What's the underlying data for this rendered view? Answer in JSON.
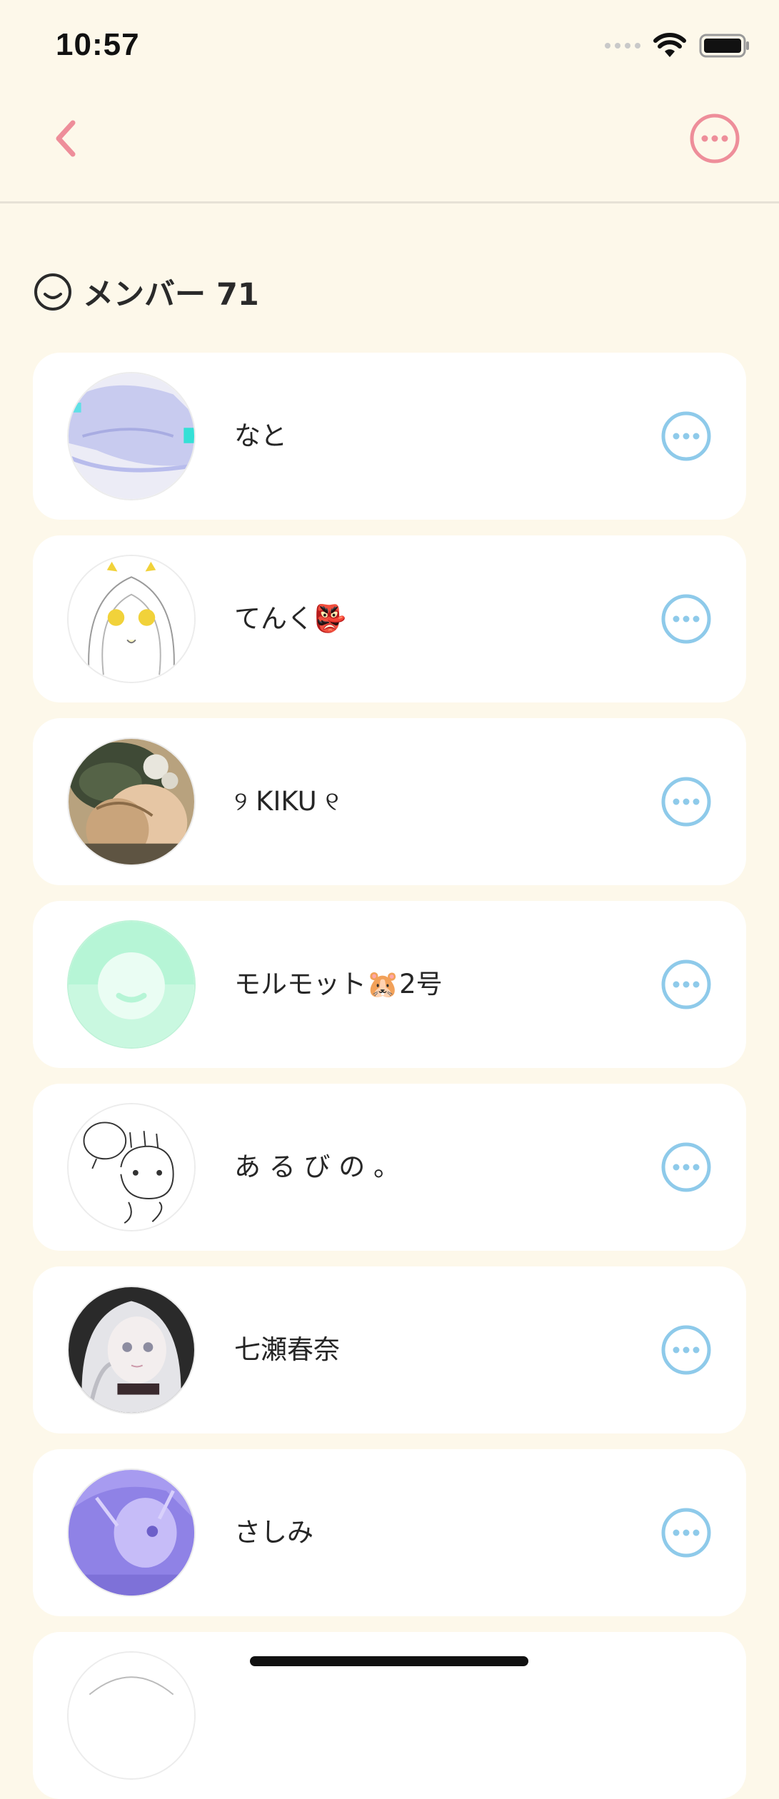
{
  "status_bar": {
    "time": "10:57"
  },
  "nav": {
    "back_icon": "chevron-left-icon",
    "more_icon": "ellipsis-circle-icon",
    "accent_color": "#EE8E9A"
  },
  "section": {
    "icon": "smiley-icon",
    "title": "メンバー 71"
  },
  "members": [
    {
      "name": "なと",
      "avatar": "avatar-lavender-creature"
    },
    {
      "name": "てんく👺",
      "avatar": "avatar-sketch-girl"
    },
    {
      "name": "୨ KIKU ୧",
      "avatar": "avatar-illustrated-girls"
    },
    {
      "name": "モルモット🐹2号",
      "avatar": "avatar-default-mint"
    },
    {
      "name": "あ る び の 。",
      "avatar": "avatar-doodle"
    },
    {
      "name": "七瀬春奈",
      "avatar": "avatar-white-hair-girl"
    },
    {
      "name": "さしみ",
      "avatar": "avatar-purple-girl"
    },
    {
      "name": "",
      "avatar": "avatar-partial"
    }
  ],
  "colors": {
    "background": "#FDF8EA",
    "card": "#FFFFFF",
    "member_more_icon": "#8ECAEA"
  }
}
